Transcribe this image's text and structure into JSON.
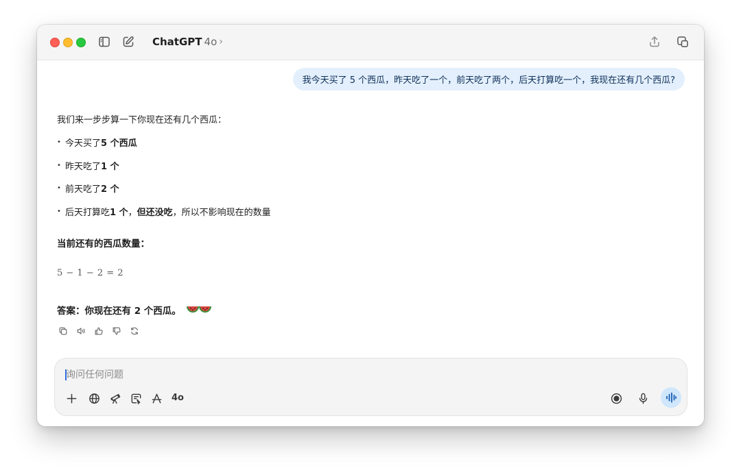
{
  "app": {
    "title": "ChatGPT",
    "model": "4o"
  },
  "conversation": {
    "user_message": "我今天买了 5 个西瓜，昨天吃了一个，前天吃了两个，后天打算吃一个，我现在还有几个西瓜?",
    "assistant": {
      "intro": "我们来一步步算一下你现在还有几个西瓜：",
      "bullets": [
        {
          "pre": "今天买了 ",
          "bold": "5 个西瓜",
          "bold2": "",
          "post": ""
        },
        {
          "pre": "昨天吃了 ",
          "bold": "1 个",
          "bold2": "",
          "post": ""
        },
        {
          "pre": "前天吃了 ",
          "bold": "2 个",
          "bold2": "",
          "post": ""
        },
        {
          "pre": "后天打算吃 ",
          "bold": "1 个",
          "sep": "，",
          "bold2": "但还没吃",
          "post": "，所以不影响现在的数量"
        }
      ],
      "heading": "当前还有的西瓜数量：",
      "formula": "5 − 1 − 2 = 2",
      "answer": "答案：你现在还有 2 个西瓜。"
    }
  },
  "composer": {
    "placeholder": "询问任何问题",
    "model_badge": "4o"
  },
  "icons": {
    "sidebar": "sidebar-toggle-icon",
    "new_chat": "compose-icon",
    "share": "share-icon",
    "window_mode": "window-overlay-icon",
    "copy": "copy-icon",
    "read_aloud": "speaker-icon",
    "thumbs_up": "thumbs-up-icon",
    "thumbs_down": "thumbs-down-icon",
    "regenerate": "refresh-icon",
    "add": "plus-icon",
    "web": "globe-icon",
    "research": "telescope-icon",
    "canvas": "canvas-icon",
    "apps": "apps-icon",
    "record": "record-icon",
    "mic": "microphone-icon",
    "voice": "voice-waveform-icon"
  },
  "colors": {
    "user_bubble": "#e3effc",
    "accent": "#2f6fe0",
    "voice_button": "#cfe6fb"
  }
}
